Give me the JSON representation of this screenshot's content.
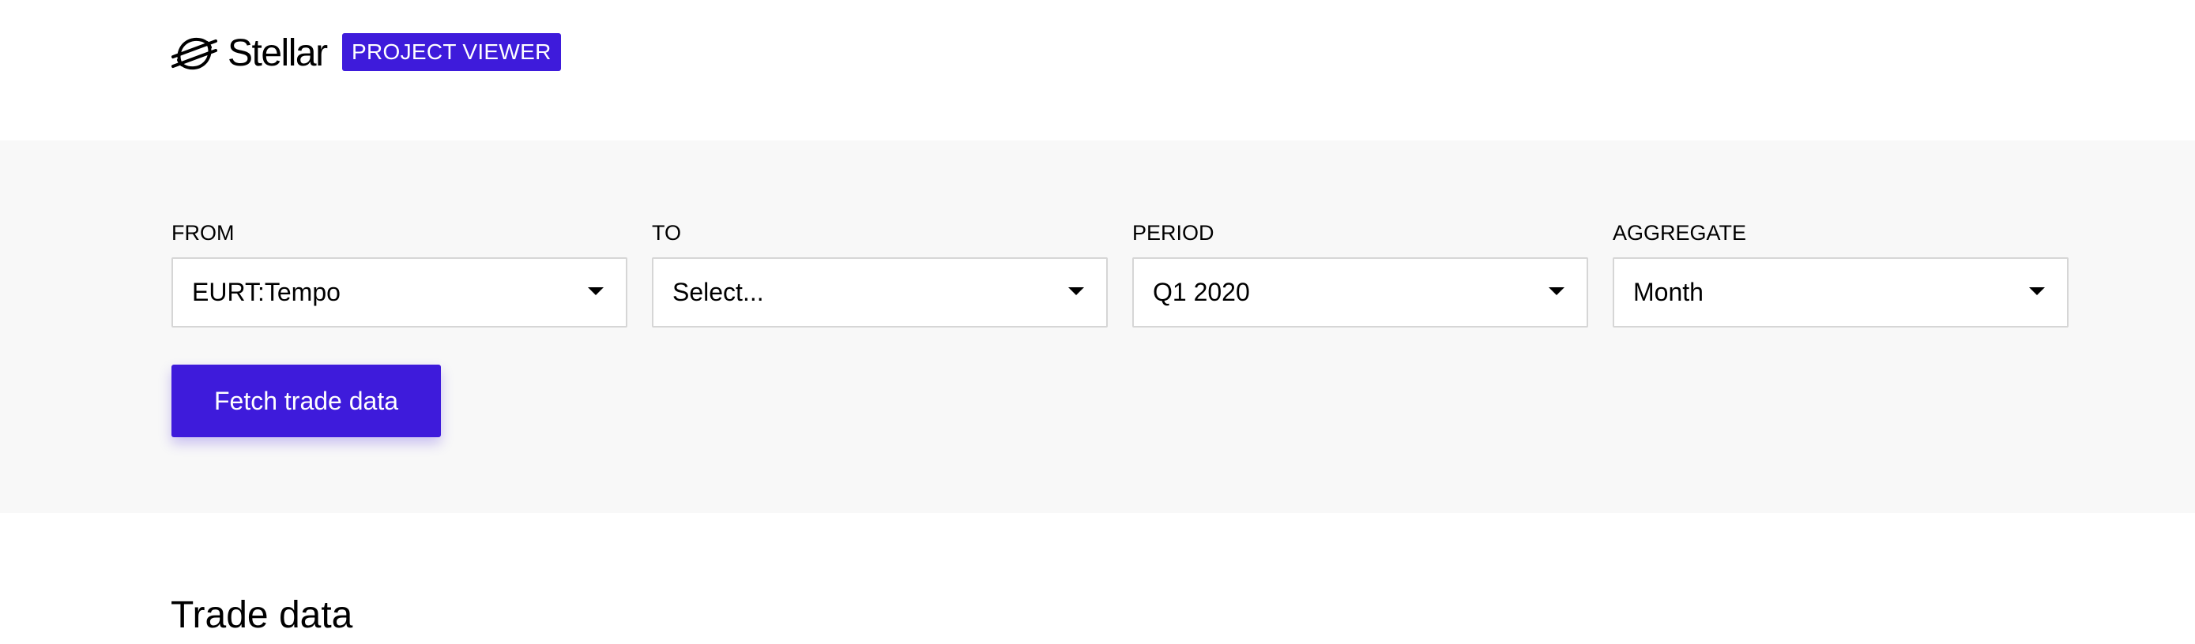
{
  "header": {
    "logo_text": "Stellar",
    "logo_icon": "stellar-logo-icon",
    "badge": "PROJECT VIEWER",
    "accent_color": "#3e1bdb"
  },
  "filters": {
    "from": {
      "label": "FROM",
      "value": "EURT:Tempo"
    },
    "to": {
      "label": "TO",
      "value": "Select..."
    },
    "period": {
      "label": "PERIOD",
      "value": "Q1 2020"
    },
    "aggregate": {
      "label": "AGGREGATE",
      "value": "Month"
    },
    "dropdown_icon": "caret-down-icon",
    "fetch_button": "Fetch trade data"
  },
  "main": {
    "section_title": "Trade data"
  }
}
